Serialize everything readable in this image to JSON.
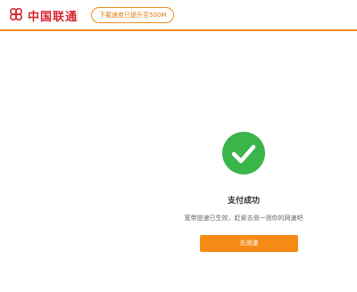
{
  "colors": {
    "accent": "#f08a1e",
    "brand_red": "#d7262f",
    "success_green": "#3ab54a",
    "button_orange": "#f58a15"
  },
  "header": {
    "logo_icon": "china-unicom-knot-logo",
    "brand_name": "中国联通",
    "speed_badge": "下载速度已提升至500M"
  },
  "result": {
    "icon": "check-circle-icon",
    "title": "支付成功",
    "subtitle": "宽带提速已生效，赶紧去测一测你的网速吧",
    "button_label": "去测速"
  }
}
